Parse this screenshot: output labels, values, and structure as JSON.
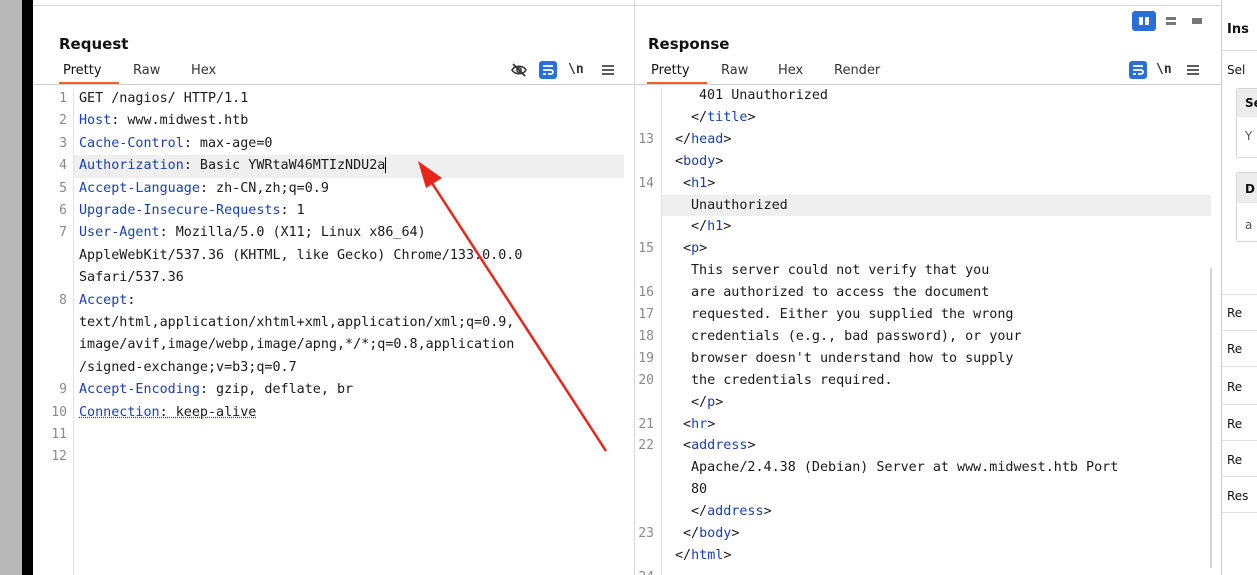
{
  "request": {
    "title": "Request",
    "tabs": [
      "Pretty",
      "Raw",
      "Hex"
    ],
    "lines": [
      {
        "n": "1",
        "parts": [
          {
            "t": "GET /nagios/ HTTP/1.1",
            "c": "p"
          }
        ]
      },
      {
        "n": "2",
        "parts": [
          {
            "t": "Host",
            "c": "k"
          },
          {
            "t": ": www.midwest.htb",
            "c": "p"
          }
        ]
      },
      {
        "n": "3",
        "parts": [
          {
            "t": "Cache-Control",
            "c": "k"
          },
          {
            "t": ": max-age=0",
            "c": "p"
          }
        ]
      },
      {
        "n": "4",
        "parts": [
          {
            "t": "Authorization",
            "c": "k"
          },
          {
            "t": ": Basic YWRtaW46MTIzNDU2a",
            "c": "p"
          }
        ]
      },
      {
        "n": "5",
        "parts": [
          {
            "t": "Accept-Language",
            "c": "k"
          },
          {
            "t": ": zh-CN,zh;q=0.9",
            "c": "p"
          }
        ]
      },
      {
        "n": "6",
        "parts": [
          {
            "t": "Upgrade-Insecure-Requests",
            "c": "k"
          },
          {
            "t": ": 1",
            "c": "p"
          }
        ]
      },
      {
        "n": "7",
        "parts": [
          {
            "t": "User-Agent",
            "c": "k"
          },
          {
            "t": ": Mozilla/5.0 (X11; Linux x86_64)",
            "c": "p"
          }
        ]
      },
      {
        "n": "",
        "parts": [
          {
            "t": "AppleWebKit/537.36 (KHTML, like Gecko) Chrome/133.0.0.0",
            "c": "p"
          }
        ]
      },
      {
        "n": "",
        "parts": [
          {
            "t": "Safari/537.36",
            "c": "p"
          }
        ]
      },
      {
        "n": "8",
        "parts": [
          {
            "t": "Accept",
            "c": "k"
          },
          {
            "t": ":",
            "c": "p"
          }
        ]
      },
      {
        "n": "",
        "parts": [
          {
            "t": "text/html,application/xhtml+xml,application/xml;q=0.9,",
            "c": "p"
          }
        ]
      },
      {
        "n": "",
        "parts": [
          {
            "t": "image/avif,image/webp,image/apng,*/*;q=0.8,application",
            "c": "p"
          }
        ]
      },
      {
        "n": "",
        "parts": [
          {
            "t": "/signed-exchange;v=b3;q=0.7",
            "c": "p"
          }
        ]
      },
      {
        "n": "9",
        "parts": [
          {
            "t": "Accept-Encoding",
            "c": "k"
          },
          {
            "t": ": gzip, deflate, br",
            "c": "p"
          }
        ]
      },
      {
        "n": "10",
        "parts": [
          {
            "t": "Connection",
            "c": "ku"
          },
          {
            "t": ": keep-alive",
            "c": "pu"
          }
        ]
      },
      {
        "n": "11",
        "parts": []
      },
      {
        "n": "12",
        "parts": []
      }
    ]
  },
  "response": {
    "title": "Response",
    "tabs": [
      "Pretty",
      "Raw",
      "Hex",
      "Render"
    ],
    "lines": [
      {
        "n": "",
        "ind": 4,
        "parts": [
          {
            "t": "401 Unauthorized",
            "c": "p"
          }
        ]
      },
      {
        "n": "",
        "ind": 3,
        "parts": [
          {
            "t": "</",
            "c": "p"
          },
          {
            "t": "title",
            "c": "k"
          },
          {
            "t": ">",
            "c": "p"
          }
        ]
      },
      {
        "n": "13",
        "ind": 1,
        "parts": [
          {
            "t": "</",
            "c": "p"
          },
          {
            "t": "head",
            "c": "k"
          },
          {
            "t": ">",
            "c": "p"
          }
        ]
      },
      {
        "n": "",
        "ind": 1,
        "parts": [
          {
            "t": "<",
            "c": "p"
          },
          {
            "t": "body",
            "c": "k"
          },
          {
            "t": ">",
            "c": "p"
          }
        ]
      },
      {
        "n": "14",
        "ind": 2,
        "parts": [
          {
            "t": "<",
            "c": "p"
          },
          {
            "t": "h1",
            "c": "k"
          },
          {
            "t": ">",
            "c": "p"
          }
        ]
      },
      {
        "n": "",
        "ind": 3,
        "parts": [
          {
            "t": "Unauthorized",
            "c": "p"
          }
        ]
      },
      {
        "n": "",
        "ind": 3,
        "parts": [
          {
            "t": "</",
            "c": "p"
          },
          {
            "t": "h1",
            "c": "k"
          },
          {
            "t": ">",
            "c": "p"
          }
        ]
      },
      {
        "n": "15",
        "ind": 2,
        "parts": [
          {
            "t": "<",
            "c": "p"
          },
          {
            "t": "p",
            "c": "k"
          },
          {
            "t": ">",
            "c": "p"
          }
        ]
      },
      {
        "n": "",
        "ind": 3,
        "parts": [
          {
            "t": "This server could not verify that you",
            "c": "p"
          }
        ]
      },
      {
        "n": "16",
        "ind": 3,
        "parts": [
          {
            "t": "are authorized to access the document",
            "c": "p"
          }
        ]
      },
      {
        "n": "17",
        "ind": 3,
        "parts": [
          {
            "t": "requested. Either you supplied the wrong",
            "c": "p"
          }
        ]
      },
      {
        "n": "18",
        "ind": 3,
        "parts": [
          {
            "t": "credentials (e.g., bad password), or your",
            "c": "p"
          }
        ]
      },
      {
        "n": "19",
        "ind": 3,
        "parts": [
          {
            "t": "browser doesn't understand how to supply",
            "c": "p"
          }
        ]
      },
      {
        "n": "20",
        "ind": 3,
        "parts": [
          {
            "t": "the credentials required.",
            "c": "p"
          }
        ]
      },
      {
        "n": "",
        "ind": 3,
        "parts": [
          {
            "t": "</",
            "c": "p"
          },
          {
            "t": "p",
            "c": "k"
          },
          {
            "t": ">",
            "c": "p"
          }
        ]
      },
      {
        "n": "21",
        "ind": 2,
        "parts": [
          {
            "t": "<",
            "c": "p"
          },
          {
            "t": "hr",
            "c": "k"
          },
          {
            "t": ">",
            "c": "p"
          }
        ]
      },
      {
        "n": "22",
        "ind": 2,
        "parts": [
          {
            "t": "<",
            "c": "p"
          },
          {
            "t": "address",
            "c": "k"
          },
          {
            "t": ">",
            "c": "p"
          }
        ]
      },
      {
        "n": "",
        "ind": 3,
        "parts": [
          {
            "t": "Apache/2.4.38 (Debian) Server at www.midwest.htb Port",
            "c": "p"
          }
        ]
      },
      {
        "n": "",
        "ind": 3,
        "parts": [
          {
            "t": "80",
            "c": "p"
          }
        ]
      },
      {
        "n": "",
        "ind": 3,
        "parts": [
          {
            "t": "</",
            "c": "p"
          },
          {
            "t": "address",
            "c": "k"
          },
          {
            "t": ">",
            "c": "p"
          }
        ]
      },
      {
        "n": "23",
        "ind": 2,
        "parts": [
          {
            "t": "</",
            "c": "p"
          },
          {
            "t": "body",
            "c": "k"
          },
          {
            "t": ">",
            "c": "p"
          }
        ]
      },
      {
        "n": "",
        "ind": 1,
        "parts": [
          {
            "t": "</",
            "c": "p"
          },
          {
            "t": "html",
            "c": "k"
          },
          {
            "t": ">",
            "c": "p"
          }
        ]
      },
      {
        "n": "24",
        "ind": 0,
        "parts": []
      }
    ]
  },
  "inspector": {
    "title": "Ins",
    "select": "Sel",
    "section1": "Se",
    "section1_val": "Y",
    "section2": "D",
    "section2_val": "a",
    "rows": [
      "Re",
      "Re",
      "Re",
      "Re",
      "Re",
      "Res"
    ]
  },
  "icons": {
    "hide": "eye-off-icon",
    "wrap": "wrap-lines-icon",
    "newline": "\\n",
    "menu": "hamburger-menu-icon"
  },
  "colors": {
    "accent_tab": "#e8622a",
    "keyword": "#1b3fb3",
    "annotation_arrow": "#e8251b",
    "layout_button": "#2a6fd8"
  }
}
